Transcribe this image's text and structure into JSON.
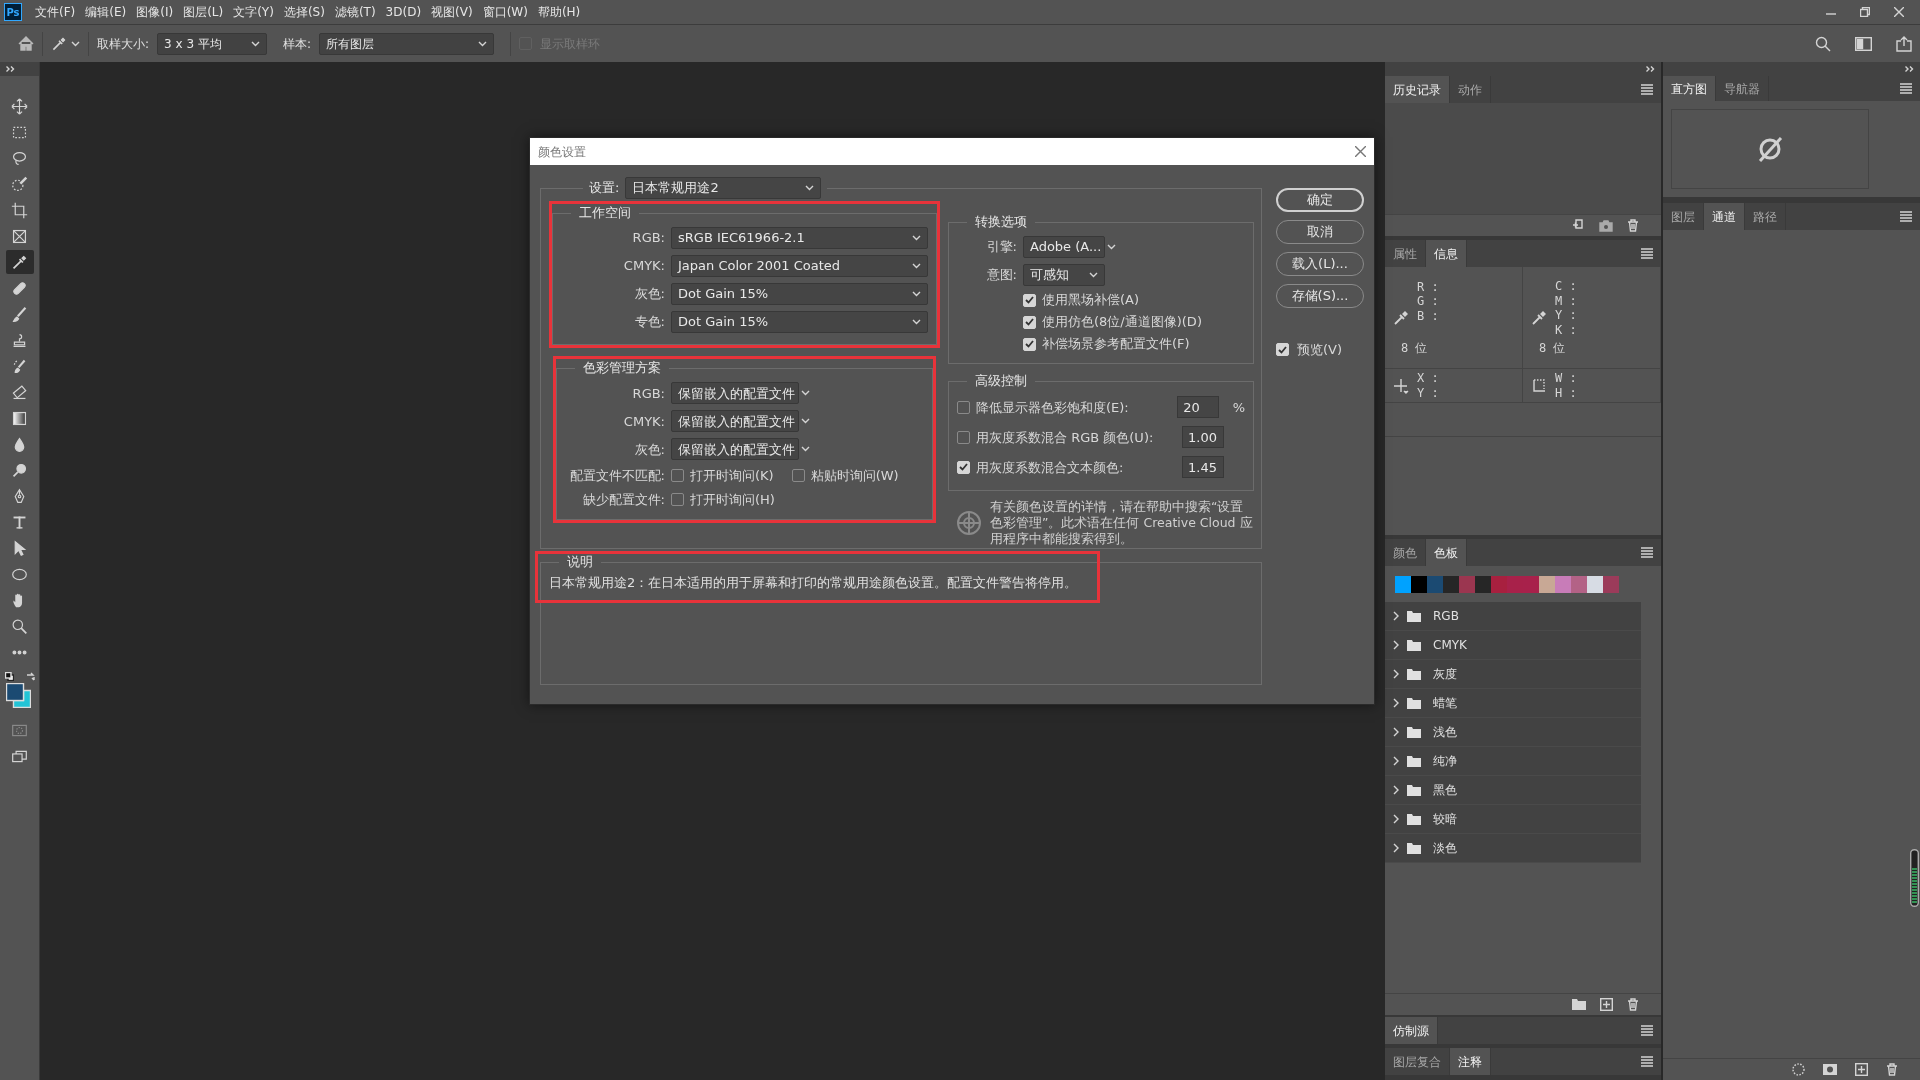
{
  "app": {
    "logo": "Ps"
  },
  "menu_bar": [
    "文件(F)",
    "编辑(E)",
    "图像(I)",
    "图层(L)",
    "文字(Y)",
    "选择(S)",
    "滤镜(T)",
    "3D(D)",
    "视图(V)",
    "窗口(W)",
    "帮助(H)"
  ],
  "options_bar": {
    "sample_size_label": "取样大小:",
    "sample_size": "3 x 3 平均",
    "sample_label": "样本:",
    "sample": "所有图层",
    "sample_ring": {
      "label": "显示取样环",
      "checked": false,
      "disabled": true
    }
  },
  "tools": [
    {
      "kind": "move",
      "selected": false
    },
    {
      "kind": "marquee",
      "selected": false
    },
    {
      "kind": "lasso",
      "selected": false
    },
    {
      "kind": "quick-select",
      "selected": false
    },
    {
      "kind": "crop",
      "selected": false
    },
    {
      "kind": "frame",
      "selected": false
    },
    {
      "kind": "eyedropper",
      "selected": true
    },
    {
      "kind": "healing",
      "selected": false
    },
    {
      "kind": "brush",
      "selected": false
    },
    {
      "kind": "stamp",
      "selected": false
    },
    {
      "kind": "history-brush",
      "selected": false
    },
    {
      "kind": "eraser",
      "selected": false
    },
    {
      "kind": "gradient",
      "selected": false
    },
    {
      "kind": "blur",
      "selected": false
    },
    {
      "kind": "dodge",
      "selected": false
    },
    {
      "kind": "pen",
      "selected": false
    },
    {
      "kind": "type",
      "selected": false
    },
    {
      "kind": "path-select",
      "selected": false
    },
    {
      "kind": "ellipse",
      "selected": false
    },
    {
      "kind": "hand",
      "selected": false
    },
    {
      "kind": "zoom",
      "selected": false
    },
    {
      "kind": "more",
      "selected": false
    }
  ],
  "tool_colors": [
    {
      "color": "#1b4a72"
    },
    {
      "color": "#22c4d6"
    }
  ],
  "dialog": {
    "title": "颜色设置",
    "settings": {
      "label": "设置:",
      "value": "日本常规用途2"
    },
    "working_spaces": {
      "title": "工作空间",
      "fields": [
        {
          "label": "RGB:",
          "value": "sRGB IEC61966-2.1"
        },
        {
          "label": "CMYK:",
          "value": "Japan Color 2001 Coated"
        },
        {
          "label": "灰色:",
          "value": "Dot Gain 15%"
        },
        {
          "label": "专色:",
          "value": "Dot Gain 15%"
        }
      ]
    },
    "color_management_policies": {
      "title": "色彩管理方案",
      "fields": [
        {
          "label": "RGB:",
          "value": "保留嵌入的配置文件"
        },
        {
          "label": "CMYK:",
          "value": "保留嵌入的配置文件"
        },
        {
          "label": "灰色:",
          "value": "保留嵌入的配置文件"
        }
      ],
      "checks": [
        {
          "label": "配置文件不匹配:",
          "options": [
            {
              "label": "打开时询问(K)",
              "checked": false
            },
            {
              "label": "粘贴时询问(W)",
              "checked": false
            }
          ]
        },
        {
          "label": "缺少配置文件:",
          "options": [
            {
              "label": "打开时询问(H)",
              "checked": false
            }
          ]
        }
      ]
    },
    "conversion_options": {
      "title": "转换选项",
      "fields": [
        {
          "label": "引擎:",
          "value": "Adobe (A..."
        },
        {
          "label": "意图:",
          "value": "可感知"
        }
      ],
      "options": [
        {
          "label": "使用黑场补偿(A)",
          "checked": true
        },
        {
          "label": "使用仿色(8位/通道图像)(D)",
          "checked": true
        },
        {
          "label": "补偿场景参考配置文件(F)",
          "checked": true
        }
      ]
    },
    "advanced_controls": {
      "title": "高级控制",
      "rows": [
        {
          "label": "降低显示器色彩饱和度(E):",
          "checked": false,
          "value": "20",
          "unit": "%"
        },
        {
          "label": "用灰度系数混合 RGB 颜色(U):",
          "checked": false,
          "value": "1.00"
        },
        {
          "label": "用灰度系数混合文本颜色:",
          "checked": true,
          "value": "1.45"
        }
      ]
    },
    "help_text": "有关颜色设置的详情，请在帮助中搜索“设置色彩管理”。此术语在任何 Creative Cloud 应用程序中都能搜索得到。",
    "description": {
      "title": "说明",
      "text": "日本常规用途2：在日本适用的用于屏幕和打印的常规用途颜色设置。配置文件警告将停用。"
    },
    "buttons": [
      {
        "label": "确定",
        "default": true
      },
      {
        "label": "取消",
        "default": false
      },
      {
        "label": "载入(L)...",
        "default": false
      },
      {
        "label": "存储(S)...",
        "default": false
      }
    ],
    "preview": {
      "label": "预览(V)",
      "checked": true
    }
  },
  "panels": {
    "history": {
      "tabs": [
        {
          "label": "历史记录",
          "selected": true
        },
        {
          "label": "动作",
          "selected": false
        }
      ]
    },
    "info": {
      "tabs": [
        {
          "label": "属性",
          "selected": false
        },
        {
          "label": "信息",
          "selected": true
        }
      ],
      "rgb": [
        "R :",
        "G :",
        "B :"
      ],
      "rgb_depth": "8 位",
      "cmyk": [
        "C :",
        "M :",
        "Y :",
        "K :"
      ],
      "cmyk_depth": "8 位",
      "position": [
        "X :",
        "Y :"
      ],
      "size": [
        "W :",
        "H :"
      ]
    },
    "swatches": {
      "tabs": [
        {
          "label": "颜色",
          "selected": false
        },
        {
          "label": "色板",
          "selected": true
        }
      ],
      "recent": [
        {
          "color": "#00a2ff"
        },
        {
          "color": "#000000"
        },
        {
          "color": "#1b4a72"
        },
        {
          "color": "#262626"
        },
        {
          "color": "#9b3650"
        },
        {
          "color": "#262626"
        },
        {
          "color": "#a8203f"
        },
        {
          "color": "#a8214a"
        },
        {
          "color": "#a8214b"
        },
        {
          "color": "#c8a895"
        },
        {
          "color": "#c87cb8"
        },
        {
          "color": "#b36286"
        },
        {
          "color": "#d7dce4"
        },
        {
          "color": "#9b3b5a"
        }
      ],
      "groups": [
        {
          "label": "RGB",
          "expanded": false
        },
        {
          "label": "CMYK",
          "expanded": false
        },
        {
          "label": "灰度",
          "expanded": false
        },
        {
          "label": "蜡笔",
          "expanded": false
        },
        {
          "label": "浅色",
          "expanded": false
        },
        {
          "label": "纯净",
          "expanded": false
        },
        {
          "label": "黑色",
          "expanded": false
        },
        {
          "label": "较暗",
          "expanded": false
        },
        {
          "label": "淡色",
          "expanded": false
        }
      ]
    },
    "clone_source": {
      "tabs": [
        {
          "label": "仿制源",
          "selected": true
        }
      ]
    },
    "comps": {
      "tabs": [
        {
          "label": "图层复合",
          "selected": false
        },
        {
          "label": "注释",
          "selected": true
        }
      ]
    },
    "histogram": {
      "tabs": [
        {
          "label": "直方图",
          "selected": true
        },
        {
          "label": "导航器",
          "selected": false
        }
      ]
    },
    "layers": {
      "tabs": [
        {
          "label": "图层",
          "selected": false
        },
        {
          "label": "通道",
          "selected": true
        },
        {
          "label": "路径",
          "selected": false
        }
      ]
    }
  }
}
